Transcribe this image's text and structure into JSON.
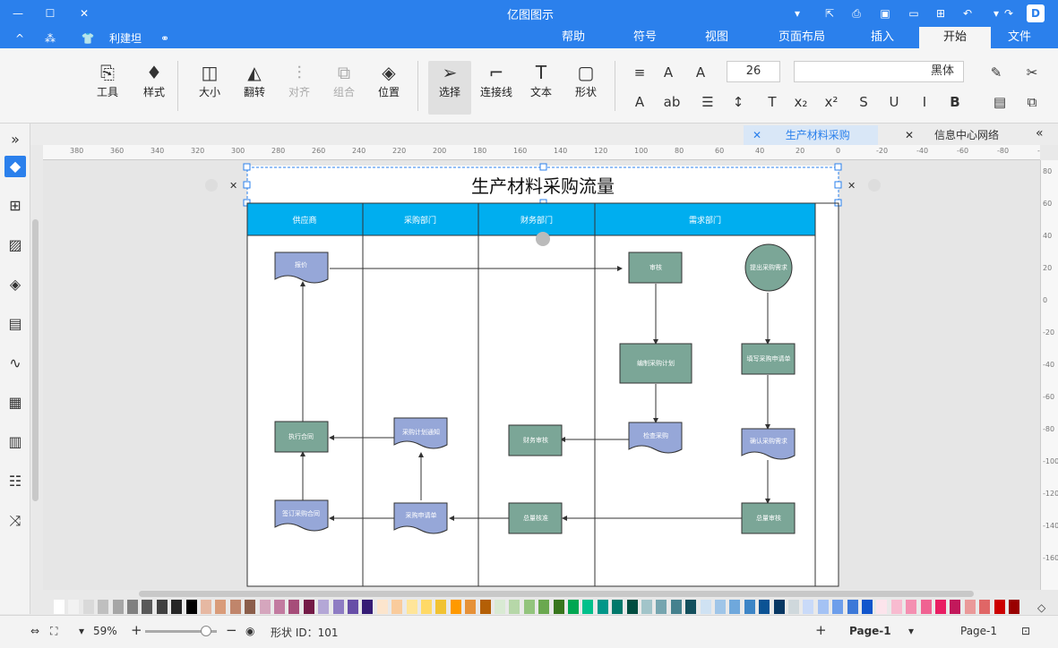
{
  "app": {
    "title": "亿图图示"
  },
  "titlebar": {
    "right_icon": "亿图 logo"
  },
  "menu": {
    "tabs": [
      "文件",
      "开始",
      "插入",
      "页面布局",
      "视图",
      "符号",
      "帮助"
    ],
    "active": "开始",
    "extra": [
      "利建坦"
    ]
  },
  "ribbon": {
    "groups": [
      {
        "label": "工具",
        "icon": "tool-icon"
      },
      {
        "label": "样式",
        "icon": "paint-bucket-icon"
      },
      {
        "label": "大小",
        "icon": "size-icon"
      },
      {
        "label": "翻转",
        "icon": "flip-icon"
      },
      {
        "label": "对齐",
        "icon": "align-icon",
        "disabled": true
      },
      {
        "label": "组合",
        "icon": "group-icon",
        "disabled": true
      },
      {
        "label": "位置",
        "icon": "layers-icon"
      },
      {
        "label": "选择",
        "icon": "cursor-icon",
        "selected": true
      },
      {
        "label": "连接线",
        "icon": "connector-icon"
      },
      {
        "label": "文本",
        "icon": "text-icon"
      },
      {
        "label": "形状",
        "icon": "shape-icon"
      }
    ],
    "font": "黑体",
    "font_size": "26"
  },
  "tabs": {
    "docs": [
      "信息中心网络",
      "生产材料采购"
    ],
    "active": "生产材料采购"
  },
  "ruler": {
    "h_labels": [
      "380",
      "360",
      "340",
      "320",
      "300",
      "280",
      "260",
      "240",
      "220",
      "200",
      "180",
      "160",
      "140",
      "120",
      "100",
      "80",
      "60",
      "40",
      "20",
      "0",
      "-20",
      "-40",
      "-60",
      "-80",
      "-100"
    ],
    "v_labels": [
      "80",
      "60",
      "40",
      "20",
      "0",
      "-20",
      "-40",
      "-60",
      "-80",
      "-100",
      "-120",
      "-140",
      "-160"
    ]
  },
  "diagram": {
    "title": "生产材料采购流量",
    "lanes": [
      "需求部门",
      "财务部门",
      "采购部门",
      "供应商"
    ],
    "nodes": {
      "start": "提出采购需求",
      "fill_form": "填写采购申请单",
      "approve": "审核",
      "confirm": "确认采购需求",
      "send_form": "采购申请单",
      "inquiry": "询价",
      "finance": "财务审核",
      "plan_notice": "采购计划通知",
      "exec": "执行合同",
      "check_send": "检查采购",
      "total": "总量审核",
      "total2": "总量核准",
      "prepare": "编制采购计划",
      "contract": "签订采购合同",
      "quote": "报价"
    }
  },
  "palette": {
    "colors": [
      "#ffffff",
      "#f2f2f2",
      "#d9d9d9",
      "#bfbfbf",
      "#a6a6a6",
      "#808080",
      "#595959",
      "#404040",
      "#262626",
      "#000000",
      "#e6b8a2",
      "#d99c7a",
      "#c0856b",
      "#8b5e4b",
      "#d5a6bd",
      "#c27ba0",
      "#a64d79",
      "#741b47",
      "#b4a7d6",
      "#8e7cc3",
      "#674ea7",
      "#351c75",
      "#fce5cd",
      "#f9cb9c",
      "#ffe599",
      "#ffd966",
      "#f1c232",
      "#ff9900",
      "#e69138",
      "#b45f06",
      "#d9ead3",
      "#b6d7a8",
      "#93c47d",
      "#6aa84f",
      "#38761d",
      "#00a651",
      "#00c08b",
      "#009688",
      "#00796b",
      "#004d40",
      "#a2c4c9",
      "#76a5af",
      "#45818e",
      "#134f5c",
      "#cfe2f3",
      "#9fc5e8",
      "#6fa8dc",
      "#3d85c6",
      "#0b5394",
      "#073763",
      "#cfd8dc",
      "#c9daf8",
      "#a4c2f4",
      "#6d9eeb",
      "#3c78d8",
      "#1155cc",
      "#fce4ec",
      "#f8bbd0",
      "#f48fb1",
      "#f06292",
      "#e91e63",
      "#c2185b",
      "#ea9999",
      "#e06666",
      "#cc0000",
      "#990000"
    ]
  },
  "status": {
    "page_nav": "Page-1",
    "page_tab": "Page-1",
    "shape_id": "形状 ID：101",
    "zoom": "59%"
  }
}
